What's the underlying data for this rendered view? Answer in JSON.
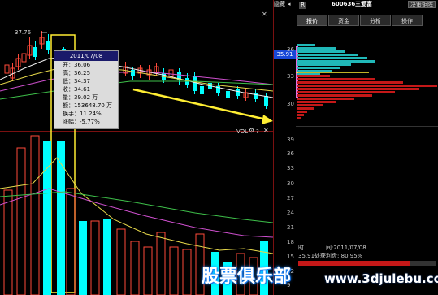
{
  "header": {
    "hide_label": "隐藏",
    "badge": "R",
    "stock_code": "600636",
    "stock_name": "三爱富",
    "trend_btn": "决策矩阵"
  },
  "tabs": [
    {
      "label": "报价"
    },
    {
      "label": "资金"
    },
    {
      "label": "分析"
    },
    {
      "label": "操作"
    }
  ],
  "kline": {
    "high_label": "37.76",
    "tooltip": {
      "date": "2011/07/08",
      "rows": [
        {
          "k": "开",
          "v": "36.06"
        },
        {
          "k": "高",
          "v": "36.25"
        },
        {
          "k": "低",
          "v": "34.37"
        },
        {
          "k": "收",
          "v": "34.61"
        },
        {
          "k": "量",
          "v": "39.02 万"
        },
        {
          "k": "额",
          "v": "153648.70 万"
        },
        {
          "k": "换手",
          "v": "11.24%"
        },
        {
          "k": "涨幅",
          "v": "-5.77%"
        }
      ]
    }
  },
  "vol": {
    "label": "VOL"
  },
  "axis": {
    "price_marker": "35.91",
    "vol_ticks": [
      "39",
      "36",
      "33",
      "30",
      "27",
      "24",
      "21",
      "18",
      "15",
      "12",
      "9"
    ]
  },
  "chip": {
    "ticks": [
      "36",
      "33",
      "30"
    ],
    "time_label": "时",
    "date_label": "间:2011/07/08",
    "profit_label": "35.91处获利盘: 80.95%"
  },
  "watermark": {
    "logo_text": "股票俱乐部",
    "url": "www.3djulebu.com"
  },
  "colors": {
    "up": "#ff4a3a",
    "down": "#00ffff",
    "axis_red": "#7a1010",
    "highlight": "#ffee33",
    "ma_white": "#f0f0f0",
    "ma_yellow": "#e6d84a",
    "ma_magenta": "#d050d0",
    "ma_green": "#3ec04a",
    "marker_blue": "#1848d8"
  },
  "icons": [
    "gear-icon",
    "question-icon",
    "close-icon",
    "trend-arrow-icon"
  ]
}
